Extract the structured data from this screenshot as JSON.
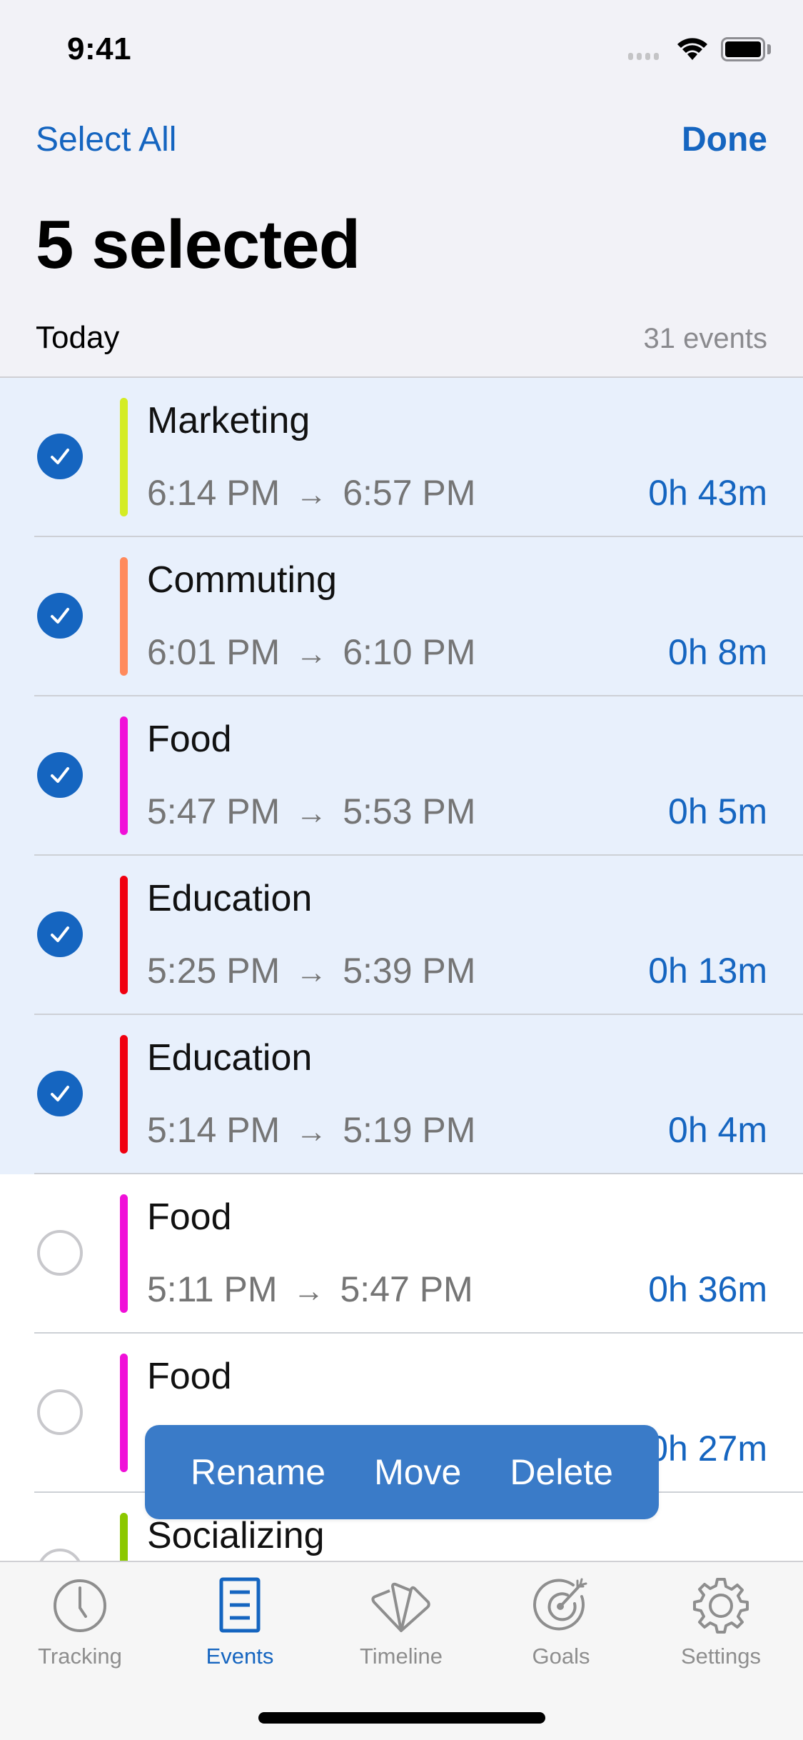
{
  "status_bar": {
    "time": "9:41"
  },
  "nav": {
    "select_all": "Select All",
    "done": "Done"
  },
  "title": "5 selected",
  "section": {
    "title": "Today",
    "count": "31 events"
  },
  "colors": {
    "accent": "#1565c0",
    "selected_row_bg": "#e8f0fc",
    "popup_bg": "#3a7bc8"
  },
  "events": [
    {
      "name": "Marketing",
      "start": "6:14 PM",
      "end": "6:57 PM",
      "duration": "0h 43m",
      "color": "#d4ec24",
      "selected": true
    },
    {
      "name": "Commuting",
      "start": "6:01 PM",
      "end": "6:10 PM",
      "duration": "0h 8m",
      "color": "#ff8a5c",
      "selected": true
    },
    {
      "name": "Food",
      "start": "5:47 PM",
      "end": "5:53 PM",
      "duration": "0h 5m",
      "color": "#f010d8",
      "selected": true
    },
    {
      "name": "Education",
      "start": "5:25 PM",
      "end": "5:39 PM",
      "duration": "0h 13m",
      "color": "#f00010",
      "selected": true
    },
    {
      "name": "Education",
      "start": "5:14 PM",
      "end": "5:19 PM",
      "duration": "0h 4m",
      "color": "#f00010",
      "selected": true
    },
    {
      "name": "Food",
      "start": "5:11 PM",
      "end": "5:47 PM",
      "duration": "0h 36m",
      "color": "#f010d8",
      "selected": false
    },
    {
      "name": "Food",
      "start": "",
      "end": "",
      "duration": "0h 27m",
      "color": "#f010d8",
      "selected": false
    },
    {
      "name": "Socializing",
      "start": "",
      "end": "",
      "duration": "",
      "color": "#8cc800",
      "selected": false
    }
  ],
  "arrow_glyph": "→",
  "action_popup": {
    "rename": "Rename",
    "move": "Move",
    "delete": "Delete"
  },
  "tabs": [
    {
      "label": "Tracking",
      "icon": "clock-icon",
      "active": false
    },
    {
      "label": "Events",
      "icon": "list-icon",
      "active": true
    },
    {
      "label": "Timeline",
      "icon": "timeline-icon",
      "active": false
    },
    {
      "label": "Goals",
      "icon": "target-icon",
      "active": false
    },
    {
      "label": "Settings",
      "icon": "gear-icon",
      "active": false
    }
  ]
}
